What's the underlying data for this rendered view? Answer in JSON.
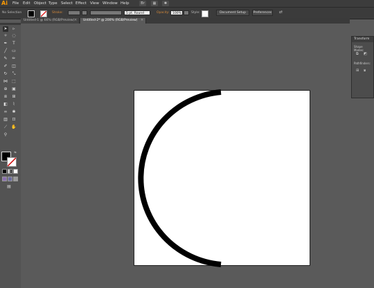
{
  "app": {
    "logo": "Ai"
  },
  "menu": [
    "File",
    "Edit",
    "Object",
    "Type",
    "Select",
    "Effect",
    "View",
    "Window",
    "Help"
  ],
  "icons": [
    "bridge-icon",
    "arrange-documents-icon"
  ],
  "control_bar": {
    "selection_label": "No Selection",
    "stroke_label": "Stroke:",
    "brush_value": "5 pt. Round",
    "opacity_label": "Opacity:",
    "opacity_value": "100%",
    "style_label": "Style:",
    "document_setup": "Document Setup",
    "preferences": "Preferences"
  },
  "tabs": [
    {
      "label": "Untitled-1 @ 66% (RGB/Preview)",
      "active": false
    },
    {
      "label": "Untitled-2* @ 200% (RGB/Preview)",
      "active": true
    }
  ],
  "panel": {
    "title": "Transform",
    "shape_modes_label": "Shape Modes:",
    "pathfinders_label": "Pathfinders:"
  },
  "colors": {
    "fill": "#000000",
    "stroke": "#ffffff",
    "accent": "#d78a3a",
    "arc": "#000000"
  }
}
